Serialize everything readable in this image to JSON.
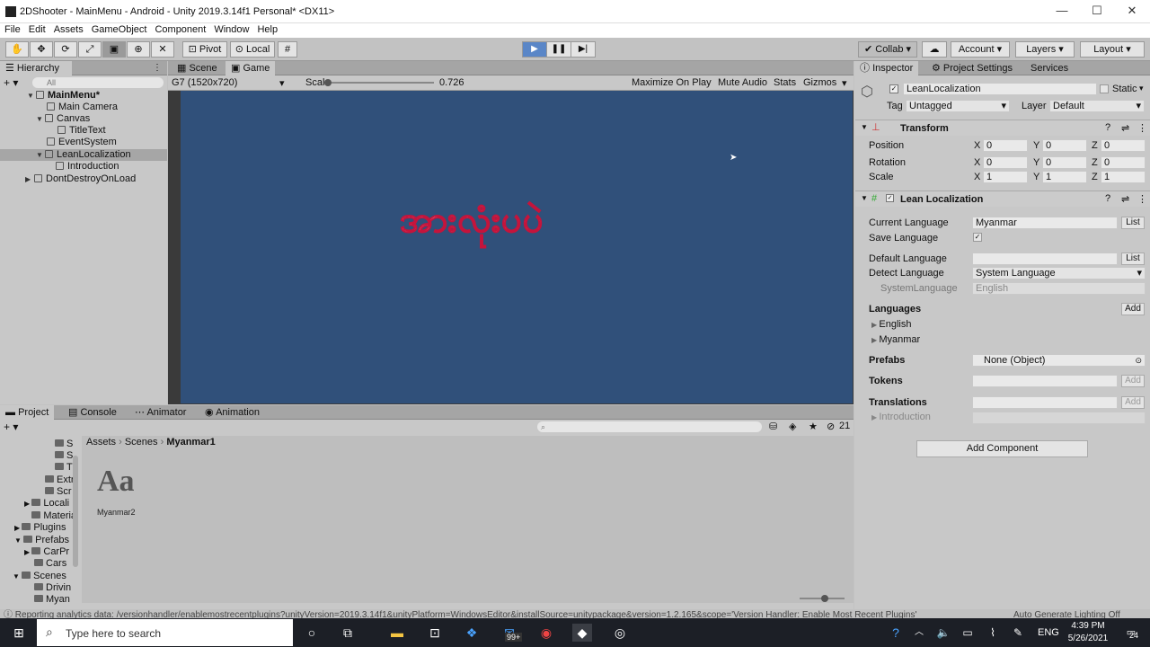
{
  "window": {
    "title": "2DShooter - MainMenu - Android - Unity 2019.3.14f1 Personal* <DX11>",
    "minimize": "—",
    "maximize": "☐",
    "close": "✕"
  },
  "menu": [
    "File",
    "Edit",
    "Assets",
    "GameObject",
    "Component",
    "Window",
    "Help"
  ],
  "toolbar": {
    "pivot": "Pivot",
    "local": "Local",
    "collab": "Collab",
    "account": "Account",
    "layers": "Layers",
    "layout": "Layout"
  },
  "hierarchy": {
    "tab": "Hierarchy",
    "search_placeholder": "All",
    "rows": [
      {
        "label": "MainMenu*",
        "indent": 0
      },
      {
        "label": "Main Camera",
        "indent": 1
      },
      {
        "label": "Canvas",
        "indent": 1
      },
      {
        "label": "TitleText",
        "indent": 2
      },
      {
        "label": "EventSystem",
        "indent": 1
      },
      {
        "label": "LeanLocalization",
        "indent": 1
      },
      {
        "label": "Introduction",
        "indent": 2
      },
      {
        "label": "DontDestroyOnLoad",
        "indent": 0
      }
    ]
  },
  "scene_tabs": {
    "scene": "Scene",
    "game": "Game"
  },
  "game_bar": {
    "resolution": "G7 (1520x720)",
    "scale_label": "Scale",
    "scale_value": "0.726",
    "maximize": "Maximize On Play",
    "mute": "Mute Audio",
    "stats": "Stats",
    "gizmos": "Gizmos"
  },
  "game_view": {
    "text": "အားလုံးပပဲ"
  },
  "inspector": {
    "tabs": {
      "inspector": "Inspector",
      "project_settings": "Project Settings",
      "services": "Services"
    },
    "object_name": "LeanLocalization",
    "static": "Static",
    "tag_label": "Tag",
    "tag": "Untagged",
    "layer_label": "Layer",
    "layer": "Default",
    "transform": {
      "title": "Transform",
      "position_label": "Position",
      "position": [
        "0",
        "0",
        "0"
      ],
      "rotation_label": "Rotation",
      "rotation": [
        "0",
        "0",
        "0"
      ],
      "scale_label": "Scale",
      "scale": [
        "1",
        "1",
        "1"
      ]
    },
    "lean": {
      "title": "Lean Localization",
      "current_language_label": "Current Language",
      "current_language": "Myanmar",
      "list": "List",
      "save_language_label": "Save Language",
      "default_language_label": "Default Language",
      "detect_language_label": "Detect Language",
      "detect_language": "System Language",
      "system_language_label": "SystemLanguage",
      "system_language": "English",
      "languages_label": "Languages",
      "add": "Add",
      "languages": [
        "English",
        "Myanmar"
      ],
      "prefabs_label": "Prefabs",
      "prefabs_value": "None (Object)",
      "tokens_label": "Tokens",
      "translations_label": "Translations",
      "translation_items": [
        "Introduction"
      ]
    },
    "add_component": "Add Component"
  },
  "project": {
    "tabs": {
      "project": "Project",
      "console": "Console",
      "animator": "Animator",
      "animation": "Animation"
    },
    "breadcrumb": [
      "Assets",
      "Scenes",
      "Myanmar1"
    ],
    "count": "21",
    "tree": [
      "S",
      "S",
      "T",
      "Extr",
      "Scr",
      "Locali",
      "Material",
      "Plugins",
      "Prefabs",
      "CarPr",
      "Cars",
      "Scenes",
      "Drivin",
      "Myan"
    ],
    "asset": {
      "glyph": "Aa",
      "name": "Myanmar2"
    }
  },
  "statusbar": {
    "text": "Reporting analytics data: /versionhandler/enablemostrecentplugins?unityVersion=2019.3.14f1&unityPlatform=WindowsEditor&installSource=unitypackage&version=1.2.165&scope='Version Handler: Enable Most Recent Plugins'",
    "right": "Auto Generate Lighting Off"
  },
  "taskbar": {
    "search_placeholder": "Type here to search",
    "lang": "ENG",
    "time": "4:39 PM",
    "date": "5/26/2021",
    "badge": "99+",
    "notif": "24"
  }
}
